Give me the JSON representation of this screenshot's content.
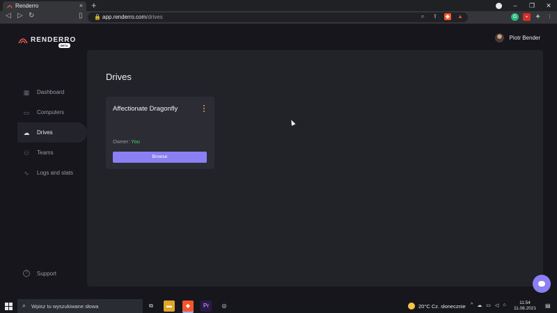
{
  "browser": {
    "tab_title": "Renderro",
    "tab_close": "×",
    "new_tab": "+",
    "url_host": "app.renderro.com",
    "url_path": "/drives",
    "win_min": "–",
    "win_max": "❐",
    "win_close": "✕"
  },
  "app": {
    "logo_text": "RENDERRO",
    "beta_label": "BETA",
    "user_name": "Piotr Bender",
    "nav": [
      {
        "label": "Dashboard",
        "icon": "grid-icon"
      },
      {
        "label": "Computers",
        "icon": "monitor-icon"
      },
      {
        "label": "Drives",
        "icon": "cloud-icon",
        "active": true
      },
      {
        "label": "Teams",
        "icon": "users-icon"
      },
      {
        "label": "Logs and stats",
        "icon": "pulse-icon"
      }
    ],
    "support_label": "Support",
    "page_title": "Drives",
    "card": {
      "title": "Affectionate Dragonfly",
      "owner_label": "Owner:",
      "owner_value": "You",
      "browse_label": "Browse"
    }
  },
  "taskbar": {
    "search_placeholder": "Wpisz tu wyszukiwane słowa",
    "weather": "20°C  Cz. słonecznie",
    "time": "11:54",
    "date": "11.08.2021"
  },
  "colors": {
    "accent": "#8a7ff3",
    "owner_you": "#48d16f",
    "logo": "#e0584f"
  }
}
